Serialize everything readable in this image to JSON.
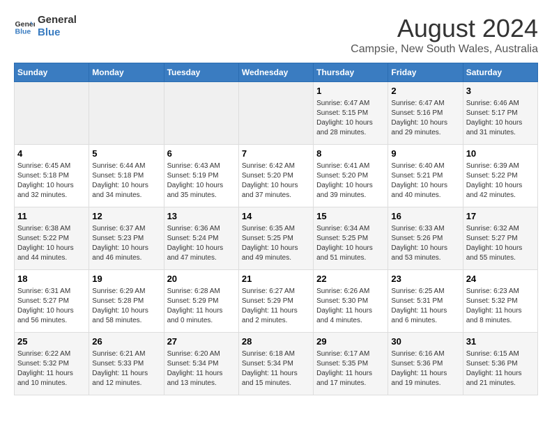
{
  "header": {
    "logo_line1": "General",
    "logo_line2": "Blue",
    "title": "August 2024",
    "subtitle": "Campsie, New South Wales, Australia"
  },
  "weekdays": [
    "Sunday",
    "Monday",
    "Tuesday",
    "Wednesday",
    "Thursday",
    "Friday",
    "Saturday"
  ],
  "weeks": [
    [
      {
        "day": "",
        "info": ""
      },
      {
        "day": "",
        "info": ""
      },
      {
        "day": "",
        "info": ""
      },
      {
        "day": "",
        "info": ""
      },
      {
        "day": "1",
        "info": "Sunrise: 6:47 AM\nSunset: 5:15 PM\nDaylight: 10 hours\nand 28 minutes."
      },
      {
        "day": "2",
        "info": "Sunrise: 6:47 AM\nSunset: 5:16 PM\nDaylight: 10 hours\nand 29 minutes."
      },
      {
        "day": "3",
        "info": "Sunrise: 6:46 AM\nSunset: 5:17 PM\nDaylight: 10 hours\nand 31 minutes."
      }
    ],
    [
      {
        "day": "4",
        "info": "Sunrise: 6:45 AM\nSunset: 5:18 PM\nDaylight: 10 hours\nand 32 minutes."
      },
      {
        "day": "5",
        "info": "Sunrise: 6:44 AM\nSunset: 5:18 PM\nDaylight: 10 hours\nand 34 minutes."
      },
      {
        "day": "6",
        "info": "Sunrise: 6:43 AM\nSunset: 5:19 PM\nDaylight: 10 hours\nand 35 minutes."
      },
      {
        "day": "7",
        "info": "Sunrise: 6:42 AM\nSunset: 5:20 PM\nDaylight: 10 hours\nand 37 minutes."
      },
      {
        "day": "8",
        "info": "Sunrise: 6:41 AM\nSunset: 5:20 PM\nDaylight: 10 hours\nand 39 minutes."
      },
      {
        "day": "9",
        "info": "Sunrise: 6:40 AM\nSunset: 5:21 PM\nDaylight: 10 hours\nand 40 minutes."
      },
      {
        "day": "10",
        "info": "Sunrise: 6:39 AM\nSunset: 5:22 PM\nDaylight: 10 hours\nand 42 minutes."
      }
    ],
    [
      {
        "day": "11",
        "info": "Sunrise: 6:38 AM\nSunset: 5:22 PM\nDaylight: 10 hours\nand 44 minutes."
      },
      {
        "day": "12",
        "info": "Sunrise: 6:37 AM\nSunset: 5:23 PM\nDaylight: 10 hours\nand 46 minutes."
      },
      {
        "day": "13",
        "info": "Sunrise: 6:36 AM\nSunset: 5:24 PM\nDaylight: 10 hours\nand 47 minutes."
      },
      {
        "day": "14",
        "info": "Sunrise: 6:35 AM\nSunset: 5:25 PM\nDaylight: 10 hours\nand 49 minutes."
      },
      {
        "day": "15",
        "info": "Sunrise: 6:34 AM\nSunset: 5:25 PM\nDaylight: 10 hours\nand 51 minutes."
      },
      {
        "day": "16",
        "info": "Sunrise: 6:33 AM\nSunset: 5:26 PM\nDaylight: 10 hours\nand 53 minutes."
      },
      {
        "day": "17",
        "info": "Sunrise: 6:32 AM\nSunset: 5:27 PM\nDaylight: 10 hours\nand 55 minutes."
      }
    ],
    [
      {
        "day": "18",
        "info": "Sunrise: 6:31 AM\nSunset: 5:27 PM\nDaylight: 10 hours\nand 56 minutes."
      },
      {
        "day": "19",
        "info": "Sunrise: 6:29 AM\nSunset: 5:28 PM\nDaylight: 10 hours\nand 58 minutes."
      },
      {
        "day": "20",
        "info": "Sunrise: 6:28 AM\nSunset: 5:29 PM\nDaylight: 11 hours\nand 0 minutes."
      },
      {
        "day": "21",
        "info": "Sunrise: 6:27 AM\nSunset: 5:29 PM\nDaylight: 11 hours\nand 2 minutes."
      },
      {
        "day": "22",
        "info": "Sunrise: 6:26 AM\nSunset: 5:30 PM\nDaylight: 11 hours\nand 4 minutes."
      },
      {
        "day": "23",
        "info": "Sunrise: 6:25 AM\nSunset: 5:31 PM\nDaylight: 11 hours\nand 6 minutes."
      },
      {
        "day": "24",
        "info": "Sunrise: 6:23 AM\nSunset: 5:32 PM\nDaylight: 11 hours\nand 8 minutes."
      }
    ],
    [
      {
        "day": "25",
        "info": "Sunrise: 6:22 AM\nSunset: 5:32 PM\nDaylight: 11 hours\nand 10 minutes."
      },
      {
        "day": "26",
        "info": "Sunrise: 6:21 AM\nSunset: 5:33 PM\nDaylight: 11 hours\nand 12 minutes."
      },
      {
        "day": "27",
        "info": "Sunrise: 6:20 AM\nSunset: 5:34 PM\nDaylight: 11 hours\nand 13 minutes."
      },
      {
        "day": "28",
        "info": "Sunrise: 6:18 AM\nSunset: 5:34 PM\nDaylight: 11 hours\nand 15 minutes."
      },
      {
        "day": "29",
        "info": "Sunrise: 6:17 AM\nSunset: 5:35 PM\nDaylight: 11 hours\nand 17 minutes."
      },
      {
        "day": "30",
        "info": "Sunrise: 6:16 AM\nSunset: 5:36 PM\nDaylight: 11 hours\nand 19 minutes."
      },
      {
        "day": "31",
        "info": "Sunrise: 6:15 AM\nSunset: 5:36 PM\nDaylight: 11 hours\nand 21 minutes."
      }
    ]
  ]
}
